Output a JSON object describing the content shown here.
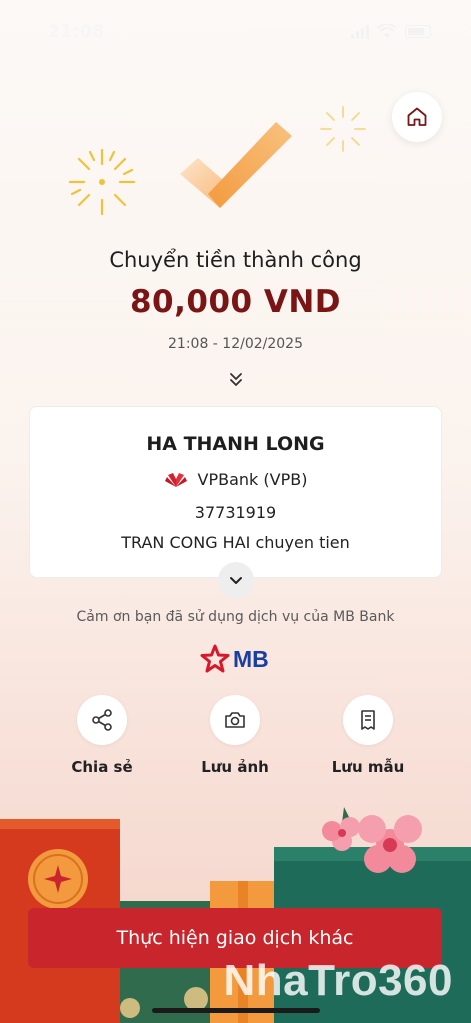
{
  "status_bar": {
    "time": "21:08"
  },
  "header": {
    "home_icon": "home-icon"
  },
  "result": {
    "title": "Chuyển tiền thành công",
    "amount": "80,000 VND",
    "datetime": "21:08 - 12/02/2025"
  },
  "recipient": {
    "name": "HA THANH LONG",
    "bank": "VPBank (VPB)",
    "account": "37731919",
    "note": "TRAN CONG HAI chuyen tien"
  },
  "thanks_text": "Cảm ơn bạn đã sử dụng dịch vụ của MB Bank",
  "brand": {
    "logo_text": "MB",
    "logo_color": "#1b3fa0",
    "star_color": "#d6182a"
  },
  "actions": [
    {
      "label": "Chia sẻ",
      "icon": "share-icon"
    },
    {
      "label": "Lưu ảnh",
      "icon": "camera-icon"
    },
    {
      "label": "Lưu mẫu",
      "icon": "receipt-icon"
    }
  ],
  "cta": {
    "label": "Thực hiện giao dịch khác",
    "color": "#c8262c"
  },
  "watermark": "NhaTro360",
  "colors": {
    "amount": "#7a1515",
    "accent_orange": "#f39a3e",
    "firework": "#f0c23a"
  }
}
